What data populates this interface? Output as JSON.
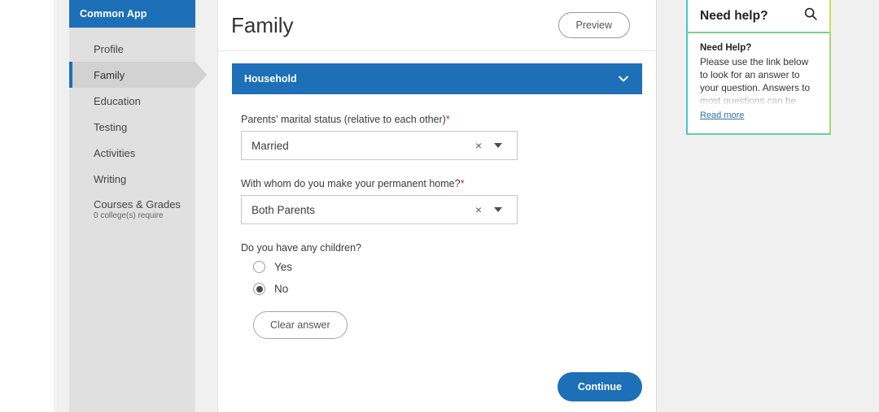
{
  "sidebar": {
    "brand": "Common App",
    "items": [
      {
        "label": "Profile",
        "sub": "",
        "active": false
      },
      {
        "label": "Family",
        "sub": "",
        "active": true
      },
      {
        "label": "Education",
        "sub": "",
        "active": false
      },
      {
        "label": "Testing",
        "sub": "",
        "active": false
      },
      {
        "label": "Activities",
        "sub": "",
        "active": false
      },
      {
        "label": "Writing",
        "sub": "",
        "active": false
      },
      {
        "label": "Courses & Grades",
        "sub": "0 college(s) require",
        "active": false
      }
    ]
  },
  "header": {
    "title": "Family",
    "preview_label": "Preview"
  },
  "section": {
    "title": "Household",
    "collapse_icon": "chevron-down-icon"
  },
  "form": {
    "marital_status": {
      "label": "Parents' marital status (relative to each other)",
      "required_marker": "*",
      "value": "Married",
      "clear_icon": "×"
    },
    "permanent_home": {
      "label": "With whom do you make your permanent home?",
      "required_marker": "*",
      "value": "Both Parents",
      "clear_icon": "×"
    },
    "children": {
      "label": "Do you have any children?",
      "options": [
        {
          "label": "Yes",
          "checked": false
        },
        {
          "label": "No",
          "checked": true
        }
      ],
      "clear_answer_label": "Clear answer"
    },
    "continue_label": "Continue"
  },
  "help": {
    "header_title": "Need help?",
    "search_icon": "search-icon",
    "card_title": "Need Help?",
    "body": "Please use the link below to look for an answer to your question. Answers to most questions can be found in",
    "read_more_label": "Read more"
  },
  "colors": {
    "brand_blue": "#1d6fb8",
    "required_red": "#d0253c",
    "sidebar_bg": "#e0e0e0",
    "active_item_bg": "#d2d2d2",
    "help_border_teal": "#3fc8c8",
    "help_border_green": "#c6e05a"
  }
}
